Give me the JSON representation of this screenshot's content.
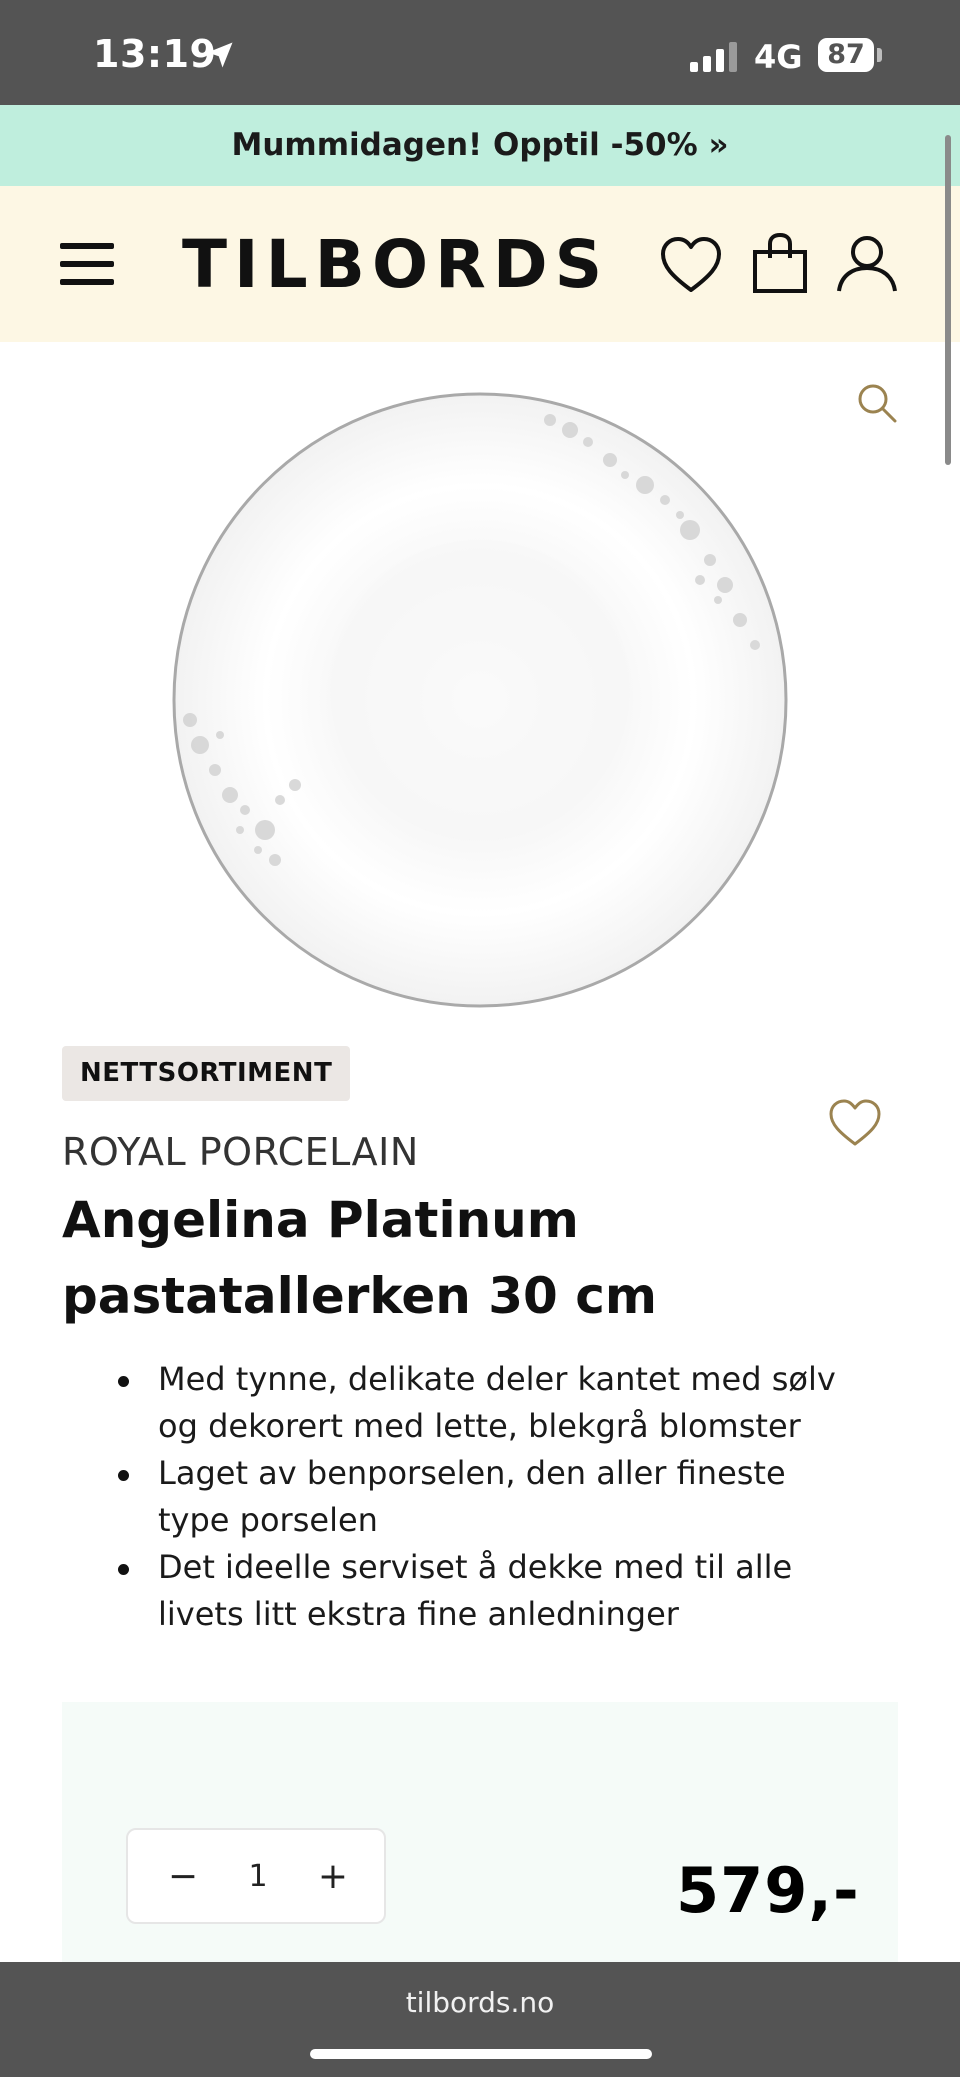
{
  "status_bar": {
    "time": "13:19",
    "network": "4G",
    "battery": "87"
  },
  "promo": {
    "text": "Mummidagen! Opptil -50% »"
  },
  "header": {
    "logo": "TILBORDS",
    "icons": [
      "menu-icon",
      "heart-icon",
      "shopping-bag-icon",
      "user-icon"
    ]
  },
  "product": {
    "badge": "NETTSORTIMENT",
    "brand": "ROYAL PORCELAIN",
    "title": "Angelina Platinum pastatallerken 30 cm",
    "features": [
      "Med tynne, delikate deler kantet med sølv og dekorert med lette, blekgrå blomster",
      "Laget av benporselen, den aller fineste type porselen",
      "Det ideelle serviset å dekke med til alle livets litt ekstra fine anledninger"
    ],
    "quantity": "1",
    "qty_minus": "−",
    "qty_plus": "+",
    "price": "579,-"
  },
  "browser": {
    "url": "tilbords.no"
  },
  "colors": {
    "promo_bg": "#bfeedd",
    "header_bg": "#fdf7e4",
    "buy_box_bg": "#f5fbf8",
    "accent_gold": "#9b8350",
    "chrome": "#545454"
  }
}
